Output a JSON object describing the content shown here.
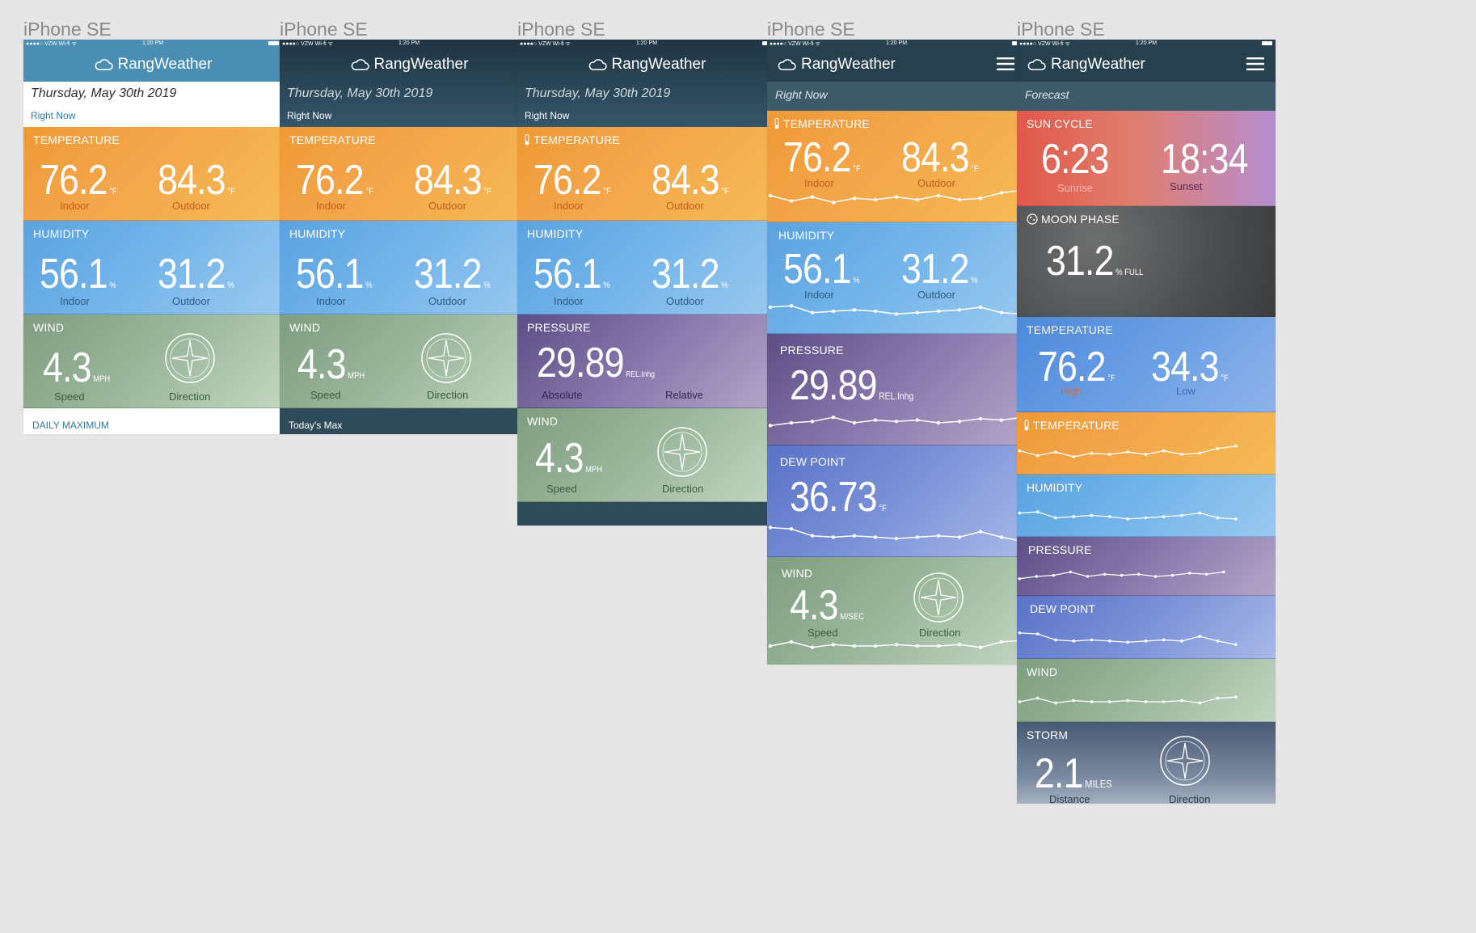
{
  "artboard_label": "iPhone SE",
  "status": {
    "carrier": "●●●●○ VZW Wi-fi ᯤ",
    "time": "1:20 PM"
  },
  "app": {
    "name": "RangWeather"
  },
  "date": "Thursday, May 30th 2019",
  "right_now": "Right Now",
  "labels": {
    "temperature": "TEMPERATURE",
    "humidity": "HUMIDITY",
    "wind": "WIND",
    "pressure": "PRESSURE",
    "dew_point": "DEW POINT",
    "sun_cycle": "SUN CYCLE",
    "moon_phase": "MOON PHASE",
    "storm": "STORM",
    "indoor": "Indoor",
    "outdoor": "Outdoor",
    "speed": "Speed",
    "direction": "Direction",
    "absolute": "Absolute",
    "relative": "Relative",
    "sunrise": "Sunrise",
    "sunset": "Sunset",
    "high": "High",
    "low": "Low",
    "distance": "Distance",
    "forecast": "Forecast"
  },
  "values": {
    "temp_indoor": "76.2",
    "temp_outdoor": "84.3",
    "temp_unit": "°F",
    "hum_indoor": "56.1",
    "hum_outdoor": "31.2",
    "hum_unit": "%",
    "wind_speed": "4.3",
    "wind_unit_mph": "MPH",
    "wind_unit_msec": "M/SEC",
    "pressure": "29.89",
    "pressure_unit": "REL.Inhg",
    "dew_point": "36.73",
    "dew_unit": "°F",
    "sunrise": "6:23",
    "sunset": "18:34",
    "moon": "31.2",
    "moon_unit": "% FULL",
    "fc_high": "76.2",
    "fc_low": "34.3",
    "storm_distance": "2.1",
    "storm_unit": "MILES"
  },
  "footers": {
    "daily_max": "DAILY MAXIMUM",
    "todays_max": "Today's Max"
  },
  "sparklines": {
    "temperature": [
      0.35,
      0.55,
      0.4,
      0.6,
      0.45,
      0.5,
      0.4,
      0.5,
      0.35,
      0.5,
      0.45,
      0.25,
      0.15
    ],
    "humidity": [
      0.35,
      0.3,
      0.55,
      0.5,
      0.45,
      0.5,
      0.6,
      0.55,
      0.5,
      0.45,
      0.35,
      0.55,
      0.6
    ],
    "pressure": [
      0.6,
      0.5,
      0.45,
      0.3,
      0.5,
      0.4,
      0.45,
      0.4,
      0.5,
      0.45,
      0.35,
      0.4,
      0.3
    ],
    "dew_point": [
      0.25,
      0.3,
      0.55,
      0.6,
      0.55,
      0.6,
      0.65,
      0.6,
      0.55,
      0.6,
      0.4,
      0.6,
      0.75
    ],
    "wind": [
      0.5,
      0.35,
      0.55,
      0.45,
      0.5,
      0.5,
      0.45,
      0.5,
      0.5,
      0.45,
      0.55,
      0.35,
      0.3
    ]
  },
  "colors": {
    "header_blue": "#4a8eb3",
    "header_dark": "#27404e",
    "accent_blue": "#3a7fa6"
  },
  "icons": [
    "cloud-icon",
    "menu-icon",
    "thermometer-icon",
    "compass-icon",
    "moon-icon"
  ]
}
